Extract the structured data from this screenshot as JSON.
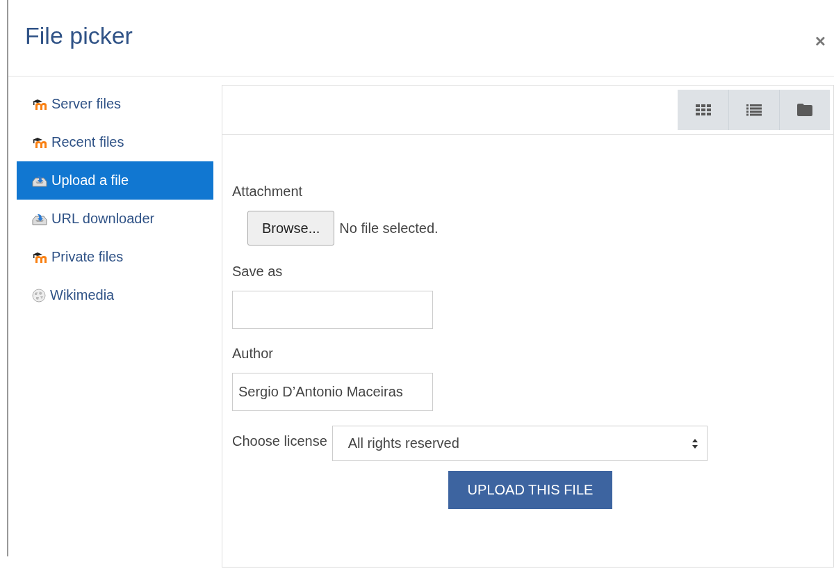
{
  "dialog": {
    "title": "File picker",
    "close": "×"
  },
  "sidebar": {
    "items": [
      {
        "label": "Server files",
        "kind": "moodle",
        "selected": false
      },
      {
        "label": "Recent files",
        "kind": "moodle",
        "selected": false
      },
      {
        "label": "Upload a file",
        "kind": "upload",
        "selected": true
      },
      {
        "label": "URL downloader",
        "kind": "upload",
        "selected": false
      },
      {
        "label": "Private files",
        "kind": "moodle",
        "selected": false
      },
      {
        "label": "Wikimedia",
        "kind": "globe",
        "selected": false
      }
    ]
  },
  "toolbar": {
    "views": [
      {
        "kind": "grid"
      },
      {
        "kind": "list"
      },
      {
        "kind": "folder"
      }
    ]
  },
  "form": {
    "attachment": {
      "label": "Attachment",
      "button": "Browse...",
      "status": "No file selected."
    },
    "save_as": {
      "label": "Save as"
    },
    "author": {
      "label": "Author",
      "value": "Sergio D’Antonio Maceiras"
    },
    "license": {
      "label": "Choose license",
      "value": "All rights reserved"
    },
    "submit": "UPLOAD THIS FILE"
  }
}
